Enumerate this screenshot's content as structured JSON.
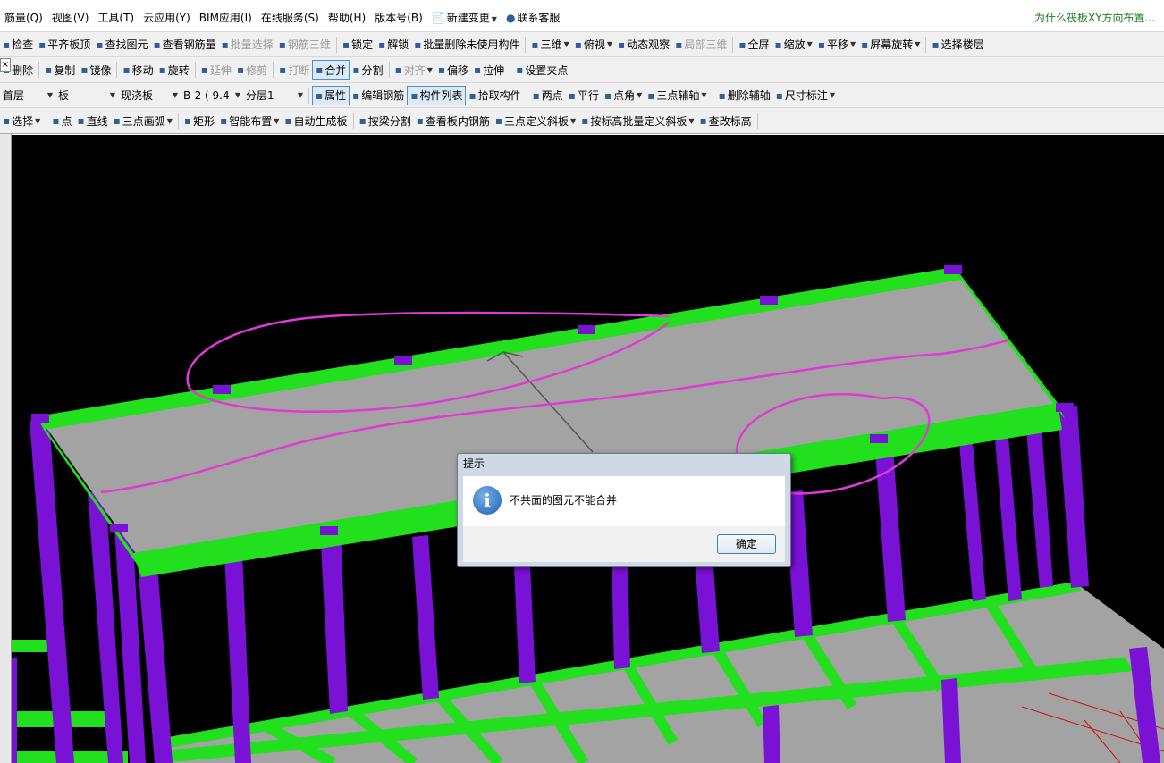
{
  "menubar": {
    "items": [
      "筋量(Q)",
      "视图(V)",
      "工具(T)",
      "云应用(Y)",
      "BIM应用(I)",
      "在线服务(S)",
      "帮助(H)",
      "版本号(B)"
    ],
    "new_change": "新建变更",
    "contact": "联系客服",
    "hint": "为什么筏板XY方向布置..."
  },
  "toolbar1": {
    "items": [
      {
        "label": "检查",
        "icon": "check-icon"
      },
      {
        "label": "平齐板顶",
        "icon": "align-slab-icon"
      },
      {
        "label": "查找图元",
        "icon": "binoculars-icon"
      },
      {
        "label": "查看钢筋量",
        "icon": "rebar-icon"
      },
      {
        "label": "批量选择",
        "icon": "batch-select-icon",
        "disabled": true
      },
      {
        "label": "钢筋三维",
        "icon": "rebar-3d-icon",
        "disabled": true
      },
      {
        "label": "锁定",
        "icon": "lock-icon"
      },
      {
        "label": "解锁",
        "icon": "unlock-icon"
      },
      {
        "label": "批量删除未使用构件",
        "icon": "batch-delete-icon"
      },
      {
        "label": "三维",
        "icon": "cube-3d-icon",
        "dropdown": true
      },
      {
        "label": "俯视",
        "icon": "top-view-icon",
        "dropdown": true
      },
      {
        "label": "动态观察",
        "icon": "orbit-icon"
      },
      {
        "label": "局部三维",
        "icon": "local-3d-icon",
        "disabled": true
      },
      {
        "label": "全屏",
        "icon": "fullscreen-icon"
      },
      {
        "label": "缩放",
        "icon": "zoom-icon",
        "dropdown": true
      },
      {
        "label": "平移",
        "icon": "pan-hand-icon",
        "dropdown": true
      },
      {
        "label": "屏幕旋转",
        "icon": "rotate-screen-icon",
        "dropdown": true
      },
      {
        "label": "选择楼层",
        "icon": "floor-select-icon"
      }
    ]
  },
  "toolbar2": {
    "items": [
      {
        "label": "删除",
        "icon": "delete-icon"
      },
      {
        "label": "复制",
        "icon": "copy-icon"
      },
      {
        "label": "镜像",
        "icon": "mirror-icon"
      },
      {
        "label": "移动",
        "icon": "move-icon"
      },
      {
        "label": "旋转",
        "icon": "rotate-icon"
      },
      {
        "label": "延伸",
        "icon": "extend-icon",
        "disabled": true
      },
      {
        "label": "修剪",
        "icon": "trim-icon",
        "disabled": true
      },
      {
        "label": "打断",
        "icon": "break-icon",
        "disabled": true
      },
      {
        "label": "合并",
        "icon": "merge-icon",
        "active": true
      },
      {
        "label": "分割",
        "icon": "split-icon"
      },
      {
        "label": "对齐",
        "icon": "align-icon",
        "disabled": true,
        "dropdown": true
      },
      {
        "label": "偏移",
        "icon": "offset-icon"
      },
      {
        "label": "拉伸",
        "icon": "stretch-icon"
      },
      {
        "label": "设置夹点",
        "icon": "grip-icon"
      }
    ]
  },
  "toolbar3": {
    "floor": "首层",
    "category": "板",
    "type": "现浇板",
    "member": "B-2 ( 9.4",
    "layer": "分层1",
    "items": [
      {
        "label": "属性",
        "icon": "properties-icon",
        "active": true
      },
      {
        "label": "编辑钢筋",
        "icon": "edit-rebar-icon"
      },
      {
        "label": "构件列表",
        "icon": "component-list-icon",
        "active": true
      },
      {
        "label": "拾取构件",
        "icon": "pick-icon"
      },
      {
        "label": "两点",
        "icon": "two-point-icon"
      },
      {
        "label": "平行",
        "icon": "parallel-icon"
      },
      {
        "label": "点角",
        "icon": "point-angle-icon",
        "dropdown": true
      },
      {
        "label": "三点辅轴",
        "icon": "three-point-axis-icon",
        "dropdown": true
      },
      {
        "label": "删除辅轴",
        "icon": "delete-axis-icon"
      },
      {
        "label": "尺寸标注",
        "icon": "dimension-icon",
        "dropdown": true
      }
    ]
  },
  "toolbar4": {
    "items": [
      {
        "label": "选择",
        "icon": "cursor-icon",
        "dropdown": true
      },
      {
        "label": "点",
        "icon": "point-icon"
      },
      {
        "label": "直线",
        "icon": "line-icon"
      },
      {
        "label": "三点画弧",
        "icon": "arc-icon",
        "dropdown": true
      },
      {
        "label": "矩形",
        "icon": "rectangle-icon"
      },
      {
        "label": "智能布置",
        "icon": "smart-layout-icon",
        "dropdown": true
      },
      {
        "label": "自动生成板",
        "icon": "auto-slab-icon"
      },
      {
        "label": "按梁分割",
        "icon": "split-by-beam-icon"
      },
      {
        "label": "查看板内钢筋",
        "icon": "view-slab-rebar-icon"
      },
      {
        "label": "三点定义斜板",
        "icon": "three-point-slope-icon",
        "dropdown": true
      },
      {
        "label": "按标高批量定义斜板",
        "icon": "batch-slope-icon",
        "dropdown": true
      },
      {
        "label": "查改标高",
        "icon": "elevation-icon"
      }
    ]
  },
  "dialog": {
    "title": "提示",
    "message": "不共面的图元不能合并",
    "ok": "确定"
  },
  "colors": {
    "background": "#000000",
    "slab": "#a3a3a3",
    "beam": "#22e01e",
    "column": "#7a12d6",
    "annotation": "#e03ad6"
  }
}
